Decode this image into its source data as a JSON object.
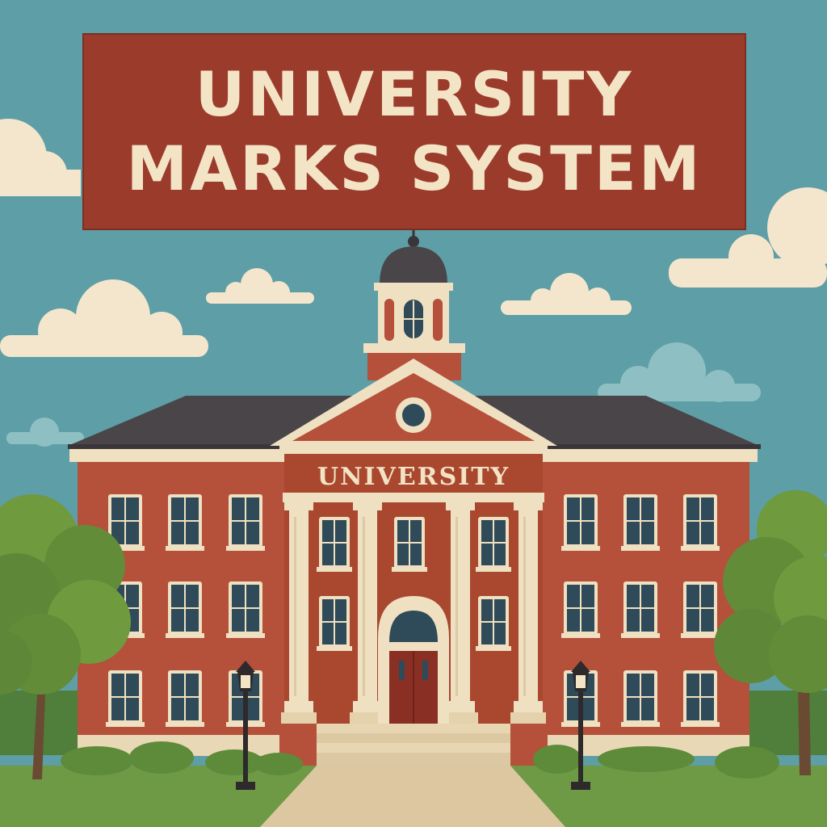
{
  "banner": {
    "line1": "UNIVERSITY",
    "line2": "MARKS SYSTEM"
  },
  "building": {
    "sign": "UNIVERSITY"
  },
  "colors": {
    "sky": "#5e9ea7",
    "banner": "#9b3b2c",
    "banner_text": "#f3e4c6",
    "brick": "#b5503a",
    "trim": "#efe0c2",
    "roof": "#4a4548",
    "grass": "#6f9a45"
  }
}
